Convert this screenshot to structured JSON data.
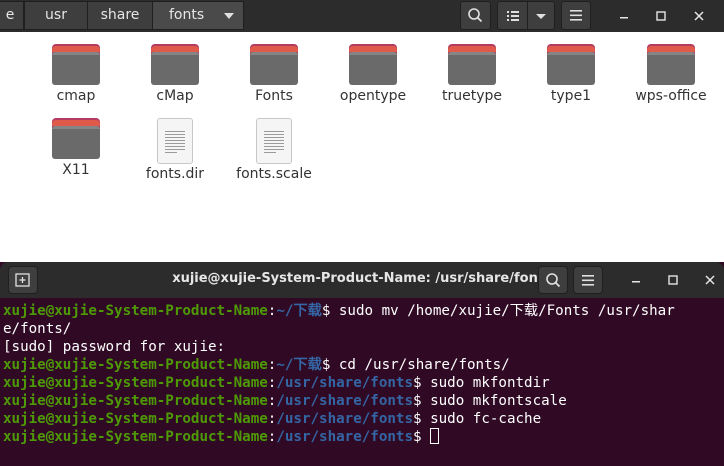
{
  "file_manager": {
    "breadcrumbs": [
      {
        "label": "e"
      },
      {
        "label": "usr"
      },
      {
        "label": "share"
      },
      {
        "label": "fonts"
      }
    ],
    "items": [
      {
        "label": "cmap",
        "kind": "folder"
      },
      {
        "label": "cMap",
        "kind": "folder"
      },
      {
        "label": "Fonts",
        "kind": "folder"
      },
      {
        "label": "opentype",
        "kind": "folder"
      },
      {
        "label": "truetype",
        "kind": "folder"
      },
      {
        "label": "type1",
        "kind": "folder"
      },
      {
        "label": "wps-office",
        "kind": "folder"
      },
      {
        "label": "X11",
        "kind": "folder"
      },
      {
        "label": "fonts.dir",
        "kind": "text-file"
      },
      {
        "label": "fonts.scale",
        "kind": "text-file"
      }
    ]
  },
  "terminal": {
    "title": "xujie@xujie-System-Product-Name: /usr/share/fonts",
    "lines": [
      {
        "user": "xujie@xujie-System-Product-Name",
        "sep": ":",
        "path": "~/下载",
        "cmd": "$ sudo mv /home/xujie/下载/Fonts /usr/shar"
      },
      {
        "text": "e/fonts/"
      },
      {
        "text": "[sudo] password for xujie:"
      },
      {
        "user": "xujie@xujie-System-Product-Name",
        "sep": ":",
        "path": "~/下载",
        "cmd": "$ cd /usr/share/fonts/"
      },
      {
        "user": "xujie@xujie-System-Product-Name",
        "sep": ":",
        "path": "/usr/share/fonts",
        "cmd": "$ sudo mkfontdir"
      },
      {
        "user": "xujie@xujie-System-Product-Name",
        "sep": ":",
        "path": "/usr/share/fonts",
        "cmd": "$ sudo mkfontscale"
      },
      {
        "user": "xujie@xujie-System-Product-Name",
        "sep": ":",
        "path": "/usr/share/fonts",
        "cmd": "$ sudo fc-cache"
      },
      {
        "user": "xujie@xujie-System-Product-Name",
        "sep": ":",
        "path": "/usr/share/fonts",
        "cmd": "$ "
      }
    ]
  },
  "colors": {
    "terminal_bg": "#300a24",
    "prompt_user": "#4e9a06",
    "prompt_path": "#3465a4",
    "folder_accent": "#b33b62"
  }
}
